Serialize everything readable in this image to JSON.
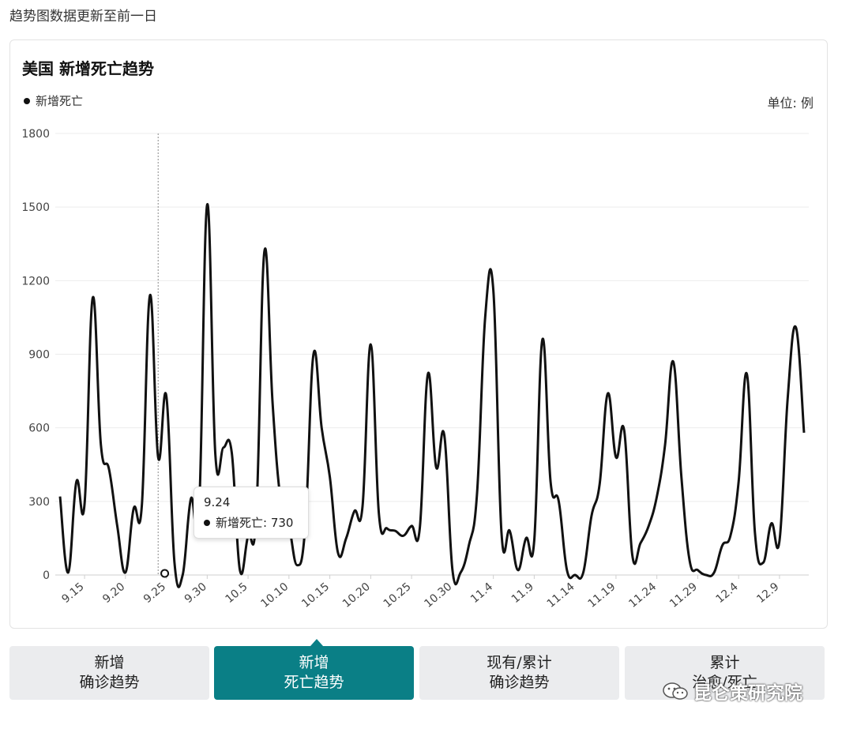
{
  "top_note": "趋势图数据更新至前一日",
  "card": {
    "title": "美国 新增死亡趋势",
    "legend_label": "新增死亡",
    "unit": "单位: 例"
  },
  "tooltip": {
    "date": "9.24",
    "series": "新增死亡",
    "value": "730",
    "text": "新增死亡: 730"
  },
  "tabs": [
    {
      "line1": "新增",
      "line2": "确诊趋势",
      "active": false
    },
    {
      "line1": "新增",
      "line2": "死亡趋势",
      "active": true
    },
    {
      "line1": "现有/累计",
      "line2": "确诊趋势",
      "active": false
    },
    {
      "line1": "累计",
      "line2": "治愈/死亡",
      "active": false
    }
  ],
  "watermark": "昆仑策研究院",
  "colors": {
    "accent": "#0a7f86",
    "line": "#111111",
    "grid": "#ececec"
  },
  "chart_data": {
    "type": "line",
    "series": [
      {
        "name": "新增死亡",
        "values": [
          320,
          10,
          380,
          290,
          1130,
          530,
          430,
          200,
          10,
          270,
          280,
          1140,
          480,
          730,
          50,
          0,
          310,
          260,
          1510,
          490,
          520,
          500,
          20,
          160,
          240,
          1320,
          700,
          300,
          200,
          40,
          200,
          900,
          600,
          400,
          90,
          150,
          260,
          280,
          940,
          250,
          190,
          180,
          160,
          200,
          190,
          820,
          440,
          570,
          20,
          10,
          120,
          330,
          1050,
          1160,
          170,
          180,
          20,
          150,
          140,
          960,
          380,
          300,
          20,
          0,
          10,
          240,
          370,
          740,
          480,
          590,
          80,
          130,
          200,
          320,
          530,
          870,
          400,
          60,
          20,
          0,
          10,
          120,
          160,
          380,
          820,
          170,
          50,
          210,
          140,
          720,
          1010,
          580
        ]
      }
    ],
    "x_tick_labels": [
      "9.15",
      "9.20",
      "9.25",
      "9.30",
      "10.5",
      "10.10",
      "10.15",
      "10.20",
      "10.25",
      "10.30",
      "11.4",
      "11.9",
      "11.14",
      "11.19",
      "11.24",
      "11.29",
      "12.4",
      "12.9"
    ],
    "y_ticks": [
      0,
      300,
      600,
      900,
      1200,
      1500,
      1800
    ],
    "ylim": [
      0,
      1800
    ],
    "grid": true,
    "highlight": {
      "date": "9.24",
      "value": 730
    }
  }
}
